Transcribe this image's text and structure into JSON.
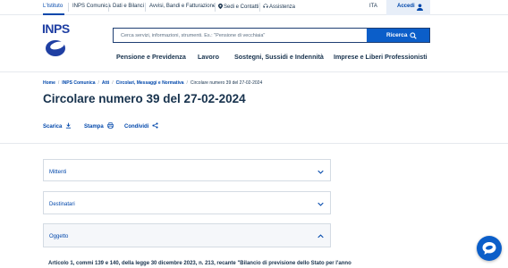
{
  "topbar": {
    "links": [
      "L'Istituto",
      "INPS Comunica",
      "Dati e Bilanci",
      "Avvisi, Bandi e Fatturazione",
      "Sedi e Contatti",
      "Assistenza"
    ],
    "language": "ITA",
    "login_label": "Accedi"
  },
  "logo_text": "INPS",
  "search": {
    "placeholder": "Cerca servizi, informazioni, strumenti. Es.: \"Pensione di vecchiaia\"",
    "button_label": "Ricerca"
  },
  "main_nav": [
    "Pensione e Previdenza",
    "Lavoro",
    "Sostegni, Sussidi e Indennità",
    "Imprese e Liberi Professionisti"
  ],
  "breadcrumb": [
    "Home",
    "INPS Comunica",
    "Atti",
    "Circolari, Messaggi e Normativa",
    "Circolare numero 39 del 27-02-2024"
  ],
  "page_title": "Circolare numero 39 del 27-02-2024",
  "actions": [
    "Scarica",
    "Stampa",
    "Condividi"
  ],
  "accordion": [
    {
      "label": "Mittenti",
      "expanded": false
    },
    {
      "label": "Destinatari",
      "expanded": false
    },
    {
      "label": "Oggetto",
      "expanded": true
    }
  ],
  "oggetto_text": "Articolo 1, commi 139 e 140, della legge 30 dicembre 2023, n. 213, recante \"Bilancio di previsione dello Stato per l'anno",
  "colors": {
    "brand": "#0047ab",
    "primary_button": "#0b5ec9",
    "text_dark": "#17324d"
  }
}
